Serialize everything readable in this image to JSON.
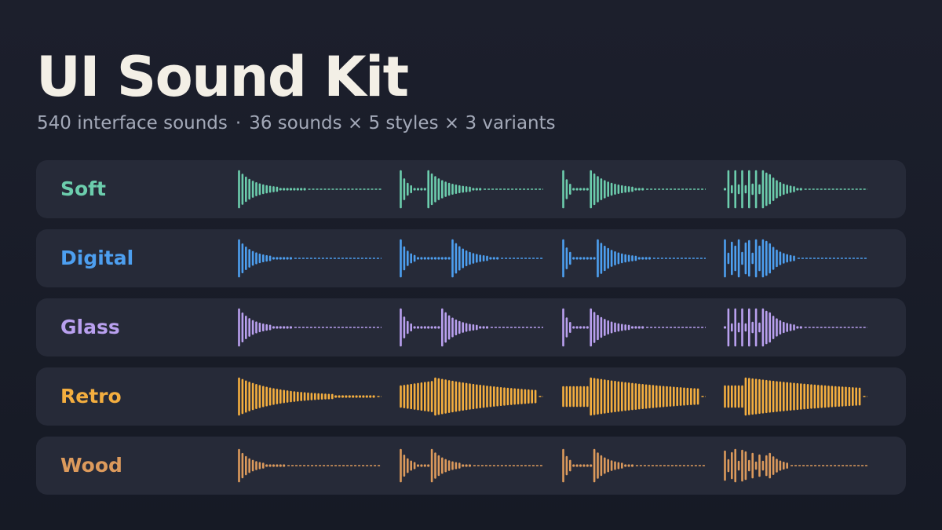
{
  "header": {
    "title": "UI Sound Kit",
    "subtitle_left": "540 interface sounds",
    "subtitle_separator": "·",
    "subtitle_right": "36 sounds × 5 styles × 3 variants"
  },
  "styles": [
    {
      "label": "Soft",
      "color": "#6ccdad",
      "waveform_icons": [
        "soft-waveform-1-icon",
        "soft-waveform-2-icon",
        "soft-waveform-3-icon",
        "soft-waveform-4-icon"
      ]
    },
    {
      "label": "Digital",
      "color": "#4d9ff0",
      "waveform_icons": [
        "digital-waveform-1-icon",
        "digital-waveform-2-icon",
        "digital-waveform-3-icon",
        "digital-waveform-4-icon"
      ]
    },
    {
      "label": "Glass",
      "color": "#b9a0ef",
      "waveform_icons": [
        "glass-waveform-1-icon",
        "glass-waveform-2-icon",
        "glass-waveform-3-icon",
        "glass-waveform-4-icon"
      ]
    },
    {
      "label": "Retro",
      "color": "#f4ae3f",
      "waveform_icons": [
        "retro-waveform-1-icon",
        "retro-waveform-2-icon",
        "retro-waveform-3-icon",
        "retro-waveform-4-icon"
      ]
    },
    {
      "label": "Wood",
      "color": "#dc9a5c",
      "waveform_icons": [
        "wood-waveform-1-icon",
        "wood-waveform-2-icon",
        "wood-waveform-3-icon",
        "wood-waveform-4-icon"
      ]
    }
  ],
  "colors": {
    "background": "#1a1d29",
    "row_background": "#262a38",
    "title": "#f3efe6",
    "subtitle": "#a3a9b8"
  }
}
